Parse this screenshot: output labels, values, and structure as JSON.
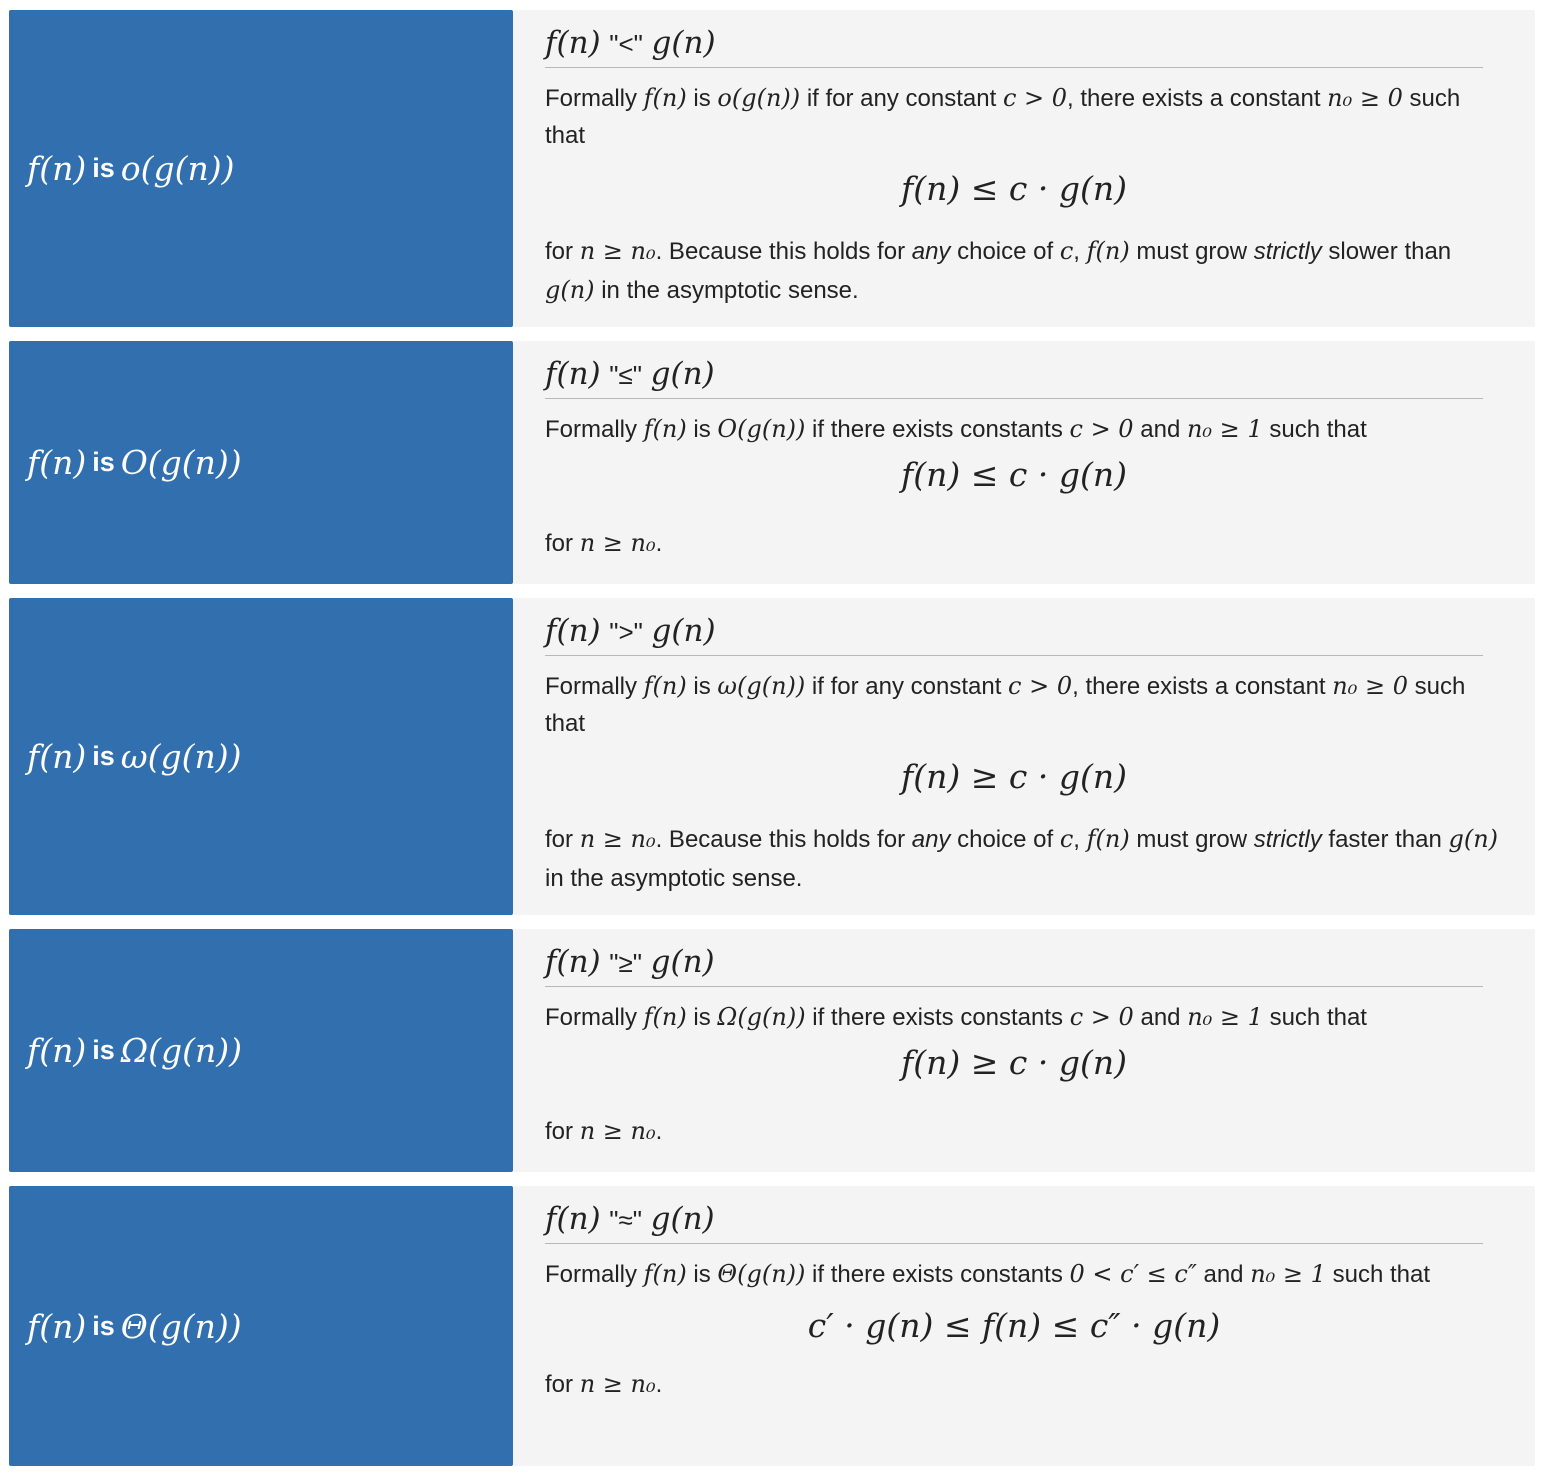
{
  "rows": [
    {
      "left": {
        "f": "f(n)",
        "is": "is",
        "notation": "o(g(n))"
      },
      "title": {
        "f": "f(n)",
        "rel": "\"<\"",
        "g": "g(n)"
      },
      "formally": {
        "pre": "Formally ",
        "f": "f(n)",
        "is": " is ",
        "notation": "o(g(n))",
        "cond1": " if for any constant ",
        "c": "c > 0",
        "cond2": ", there exists a constant ",
        "n0": "n₀ ≥ 0",
        "tail": " such that"
      },
      "equation": "f(n) ≤ c · g(n)",
      "foot": {
        "for": "for ",
        "n": "n ≥ n₀",
        "t1": ". Because this holds for ",
        "any": "any",
        "t2": " choice of ",
        "c": "c",
        "t3": ", ",
        "f": "f(n)",
        "t4": " must grow ",
        "strictly": "strictly",
        "t5": " slower than ",
        "g": "g(n)",
        "t6": " in the asymptotic sense."
      }
    },
    {
      "left": {
        "f": "f(n)",
        "is": "is",
        "notation": "O(g(n))"
      },
      "title": {
        "f": "f(n)",
        "rel": "\"≤\"",
        "g": "g(n)"
      },
      "formally": {
        "pre": "Formally ",
        "f": "f(n)",
        "is": " is ",
        "notation": "O(g(n))",
        "cond1": " if there exists constants ",
        "c": "c > 0",
        "cond2": " and ",
        "n0": "n₀ ≥ 1",
        "tail": " such that"
      },
      "equation": "f(n) ≤ c · g(n)",
      "foot": {
        "for": "for ",
        "n": "n ≥ n₀",
        "end": "."
      }
    },
    {
      "left": {
        "f": "f(n)",
        "is": "is",
        "notation": "ω(g(n))"
      },
      "title": {
        "f": "f(n)",
        "rel": "\">\"",
        "g": "g(n)"
      },
      "formally": {
        "pre": "Formally ",
        "f": "f(n)",
        "is": " is ",
        "notation": "ω(g(n))",
        "cond1": " if for any constant ",
        "c": "c > 0",
        "cond2": ", there exists a constant ",
        "n0": "n₀ ≥ 0",
        "tail": " such that"
      },
      "equation": "f(n) ≥ c · g(n)",
      "foot": {
        "for": "for ",
        "n": "n ≥ n₀",
        "t1": ". Because this holds for ",
        "any": "any",
        "t2": " choice of ",
        "c": "c",
        "t3": ", ",
        "f": "f(n)",
        "t4": " must grow ",
        "strictly": "strictly",
        "t5": " faster than ",
        "g": "g(n)",
        "t6": " in the asymptotic sense."
      }
    },
    {
      "left": {
        "f": "f(n)",
        "is": "is",
        "notation": "Ω(g(n))"
      },
      "title": {
        "f": "f(n)",
        "rel": "\"≥\"",
        "g": "g(n)"
      },
      "formally": {
        "pre": "Formally ",
        "f": "f(n)",
        "is": " is ",
        "notation": "Ω(g(n))",
        "cond1": " if there exists constants ",
        "c": "c > 0",
        "cond2": " and ",
        "n0": "n₀ ≥ 1",
        "tail": " such that"
      },
      "equation": "f(n) ≥ c · g(n)",
      "foot": {
        "for": "for ",
        "n": "n ≥ n₀",
        "end": "."
      }
    },
    {
      "left": {
        "f": "f(n)",
        "is": "is",
        "notation": "Θ(g(n))"
      },
      "title": {
        "f": "f(n)",
        "rel": "\"≈\"",
        "g": "g(n)"
      },
      "formally": {
        "pre": "Formally ",
        "f": "f(n)",
        "is": " is ",
        "notation": "Θ(g(n))",
        "cond1": " if there exists constants ",
        "c": "0 < c′ ≤ c″",
        "cond2": " and ",
        "n0": "n₀ ≥ 1",
        "tail": " such that"
      },
      "equation": "c′ · g(n) ≤ f(n) ≤ c″ · g(n)",
      "foot": {
        "for": "for ",
        "n": "n ≥ n₀",
        "end": "."
      }
    }
  ],
  "colors": {
    "left_bg": "#316fae",
    "right_bg": "#f4f4f4"
  }
}
